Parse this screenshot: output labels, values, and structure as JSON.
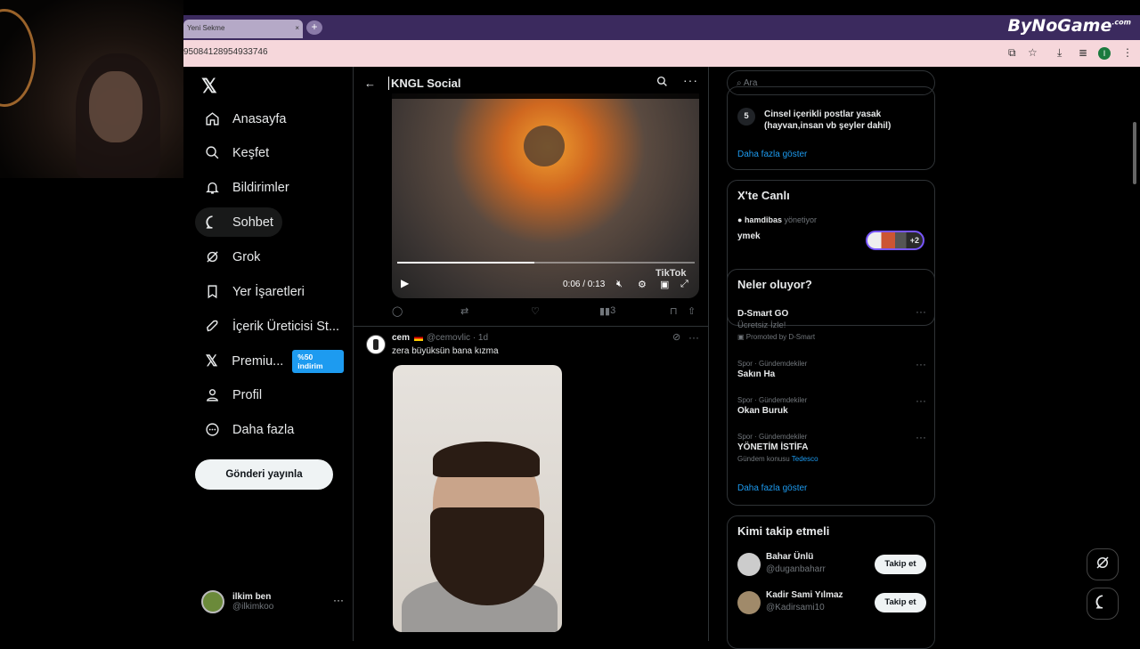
{
  "browser": {
    "tab_title": "Yeni Sekme",
    "tab_close": "×",
    "new_tab": "+",
    "brand": "ByNoGame",
    "brand_sup": ".com",
    "url": "95084128954933746",
    "profile_initial": "I"
  },
  "nav": {
    "items": [
      {
        "label": "Anasayfa",
        "icon": "home-icon"
      },
      {
        "label": "Keşfet",
        "icon": "search-icon"
      },
      {
        "label": "Bildirimler",
        "icon": "bell-icon"
      },
      {
        "label": "Sohbet",
        "icon": "chat-icon"
      },
      {
        "label": "Grok",
        "icon": "grok-icon"
      },
      {
        "label": "Yer İşaretleri",
        "icon": "bookmark-icon"
      },
      {
        "label": "İçerik Üreticisi St...",
        "icon": "rocket-icon"
      },
      {
        "label": "Premiu...",
        "icon": "x-icon"
      },
      {
        "label": "Profil",
        "icon": "person-icon"
      },
      {
        "label": "Daha fazla",
        "icon": "more-circle-icon"
      }
    ],
    "premium_badge": "%50 indirim",
    "post_button": "Gönderi yayınla",
    "account": {
      "name": "ilkim ben",
      "handle": "@ilkimkoo",
      "more": "···"
    }
  },
  "main": {
    "title": "KNGL Social",
    "video": {
      "time": "0:06 / 0:13",
      "watermark": "TikTok",
      "progress": 0.46
    },
    "actions": {
      "views": "3"
    },
    "tweet": {
      "name": "cem",
      "handle": "@cemovlic · 1d",
      "text": "zera büyüksün bana kızma"
    }
  },
  "right": {
    "search_placeholder": "Ara",
    "rules": {
      "number": "5",
      "text": "Cinsel içerikli postlar yasak (hayvan,insan vb şeyler dahil)",
      "more": "Daha fazla göster"
    },
    "live": {
      "title": "X'te Canlı",
      "user": "hamdibas",
      "role": "yönetiyor",
      "topic": "ymek",
      "extra": "+2"
    },
    "trends": {
      "title": "Neler oluyor?",
      "promo": {
        "name": "D-Smart GO",
        "sub": "Ücretsiz İzle!",
        "promoted": "Promoted by D-Smart"
      },
      "items": [
        {
          "context": "Spor · Gündemdekiler",
          "name": "Sakın Ha"
        },
        {
          "context": "Spor · Gündemdekiler",
          "name": "Okan Buruk"
        },
        {
          "context": "Spor · Gündemdekiler",
          "name": "YÖNETİM İSTİFA",
          "topic_label": "Gündem konusu",
          "topic": "Tedesco"
        }
      ],
      "more": "Daha fazla göster"
    },
    "who": {
      "title": "Kimi takip etmeli",
      "users": [
        {
          "name": "Bahar Ünlü",
          "handle": "@duganbaharr",
          "button": "Takip et"
        },
        {
          "name": "Kadir Sami Yılmaz",
          "handle": "@Kadirsami10",
          "button": "Takip et"
        }
      ]
    }
  }
}
